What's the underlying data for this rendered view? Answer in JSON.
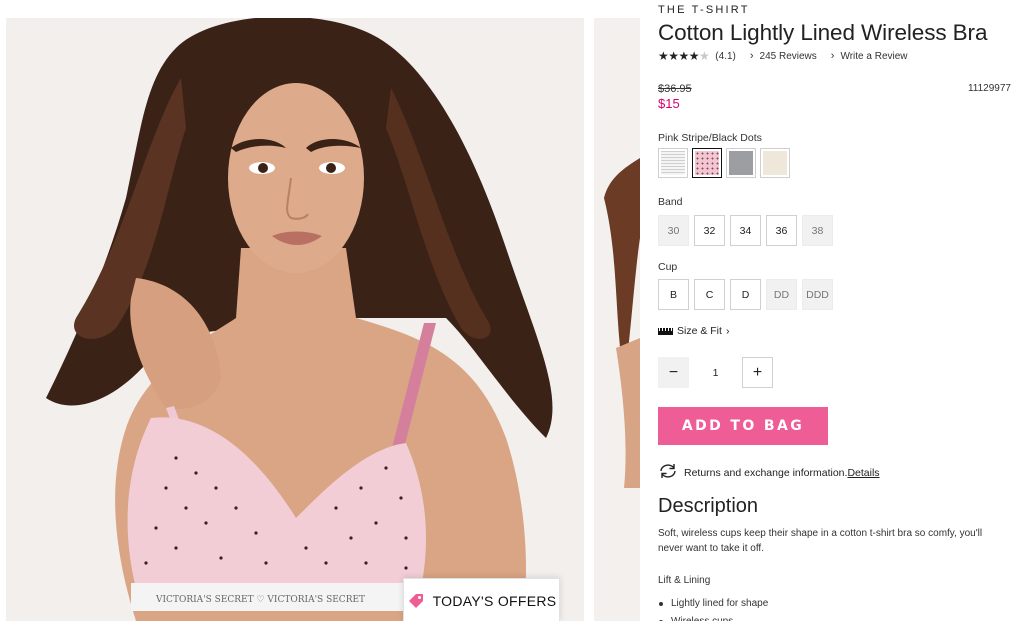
{
  "gallery": {
    "main_image_alt": "",
    "offers_button_label": "TODAY'S OFFERS"
  },
  "product": {
    "eyebrow": "THE T-SHIRT",
    "title": "Cotton Lightly Lined Wireless Bra",
    "rating": {
      "stars": 4.1,
      "value_text": "(4.1)",
      "reviews_label": "245 Reviews",
      "write_review_label": "Write a Review"
    },
    "price_original": "$36.95",
    "price_sale": "$15",
    "sku": "11129977",
    "color": {
      "selected_label": "Pink Stripe/Black Dots",
      "swatches": [
        {
          "name": "Black Stripe",
          "color": "#e9e9e9"
        },
        {
          "name": "Pink Stripe/Black Dots",
          "color": "#f3c7d2"
        },
        {
          "name": "Heather Grey",
          "color": "#9d9ea2"
        },
        {
          "name": "Ivory",
          "color": "#efe8da"
        }
      ]
    },
    "band": {
      "label": "Band",
      "options": [
        {
          "label": "30",
          "available": false
        },
        {
          "label": "32",
          "available": true
        },
        {
          "label": "34",
          "available": true
        },
        {
          "label": "36",
          "available": true
        },
        {
          "label": "38",
          "available": false
        }
      ]
    },
    "cup": {
      "label": "Cup",
      "options": [
        {
          "label": "B",
          "available": true
        },
        {
          "label": "C",
          "available": true
        },
        {
          "label": "D",
          "available": true
        },
        {
          "label": "DD",
          "available": false
        },
        {
          "label": "DDD",
          "available": false
        }
      ]
    },
    "size_fit_label": "Size & Fit",
    "quantity": {
      "value": "1",
      "minus": "−",
      "plus": "+"
    },
    "add_to_bag_label": "ADD TO BAG",
    "returns_text": "Returns and exchange information.",
    "returns_link": "Details",
    "description_heading": "Description",
    "description_text": "Soft, wireless cups keep their shape in a cotton t-shirt bra so comfy, you'll never want to take it off.",
    "lift_lining_heading": "Lift & Lining",
    "lift_lining_items": [
      "Lightly lined for shape",
      "Wireless cups"
    ]
  },
  "colors": {
    "accent_pink": "#ef5d97",
    "sale_red": "#d6006d"
  }
}
